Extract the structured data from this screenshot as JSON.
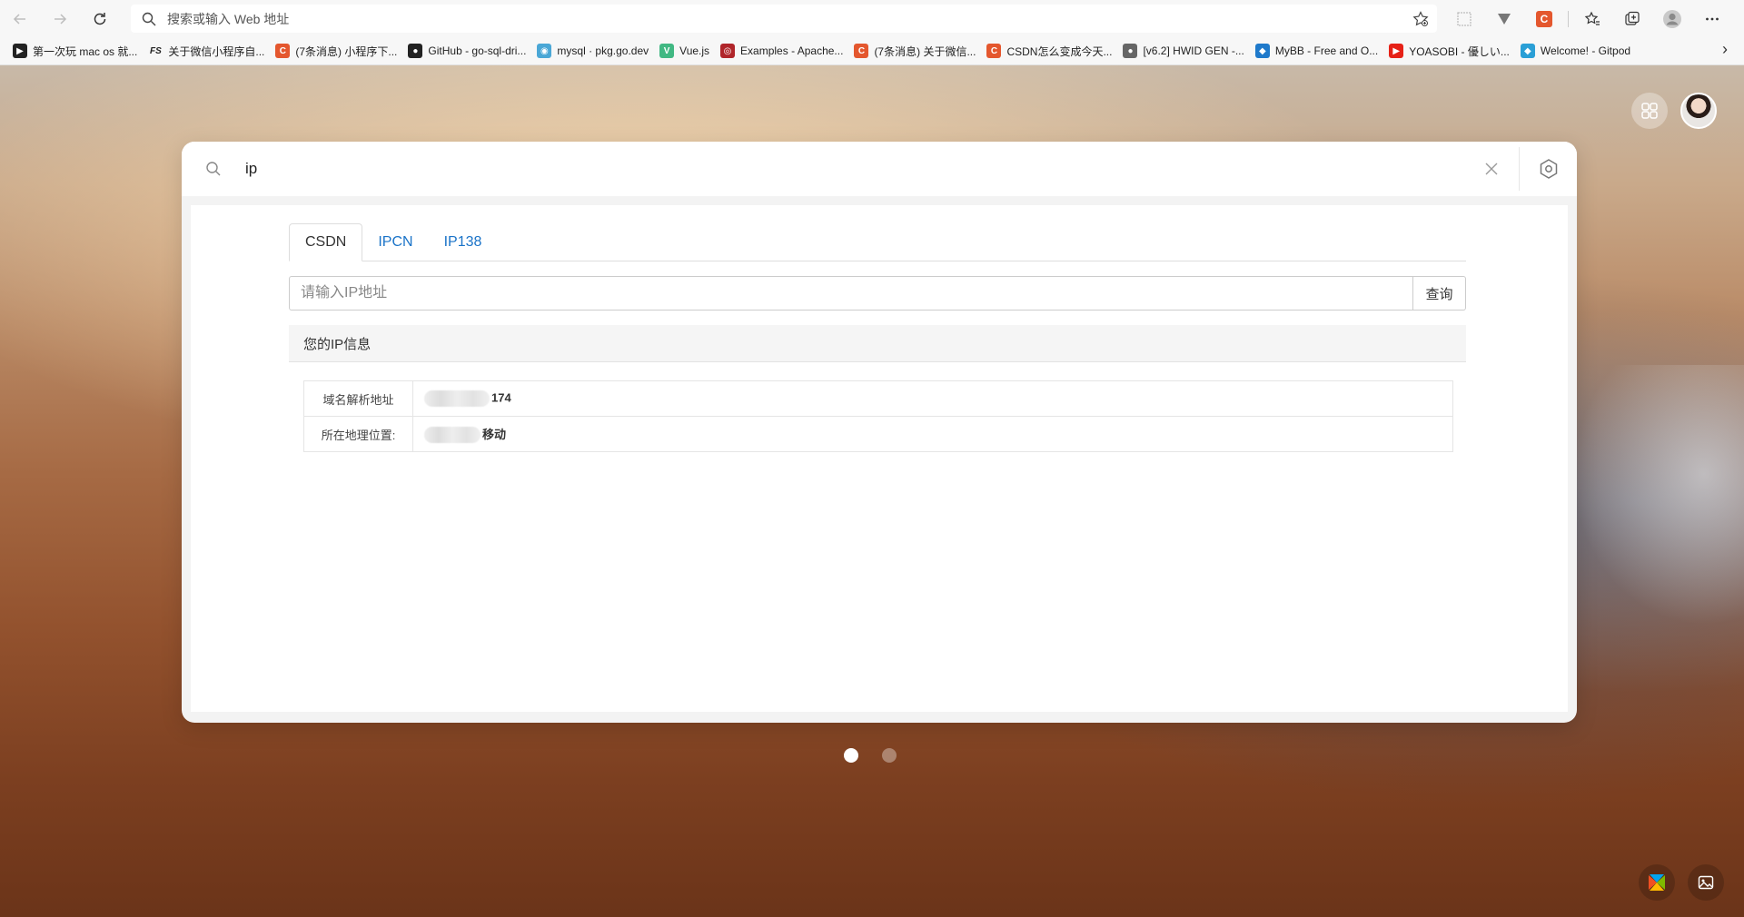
{
  "browser": {
    "address_placeholder": "搜索或输入 Web 地址",
    "bookmarks": [
      {
        "label": "第一次玩 mac os 就...",
        "icon": "vmware-icon",
        "color": "#222"
      },
      {
        "label": "关于微信小程序自...",
        "icon": "fs-icon",
        "color": "#222"
      },
      {
        "label": "(7条消息) 小程序下...",
        "icon": "csdn-icon",
        "color": "#e4572e"
      },
      {
        "label": "GitHub - go-sql-dri...",
        "icon": "github-icon",
        "color": "#222"
      },
      {
        "label": "mysql · pkg.go.dev",
        "icon": "gopher-icon",
        "color": "#4aa7d6"
      },
      {
        "label": "Vue.js",
        "icon": "vue-icon",
        "color": "#41b883"
      },
      {
        "label": "Examples - Apache...",
        "icon": "apache-icon",
        "color": "#b0252a"
      },
      {
        "label": "(7条消息) 关于微信...",
        "icon": "csdn-icon",
        "color": "#e4572e"
      },
      {
        "label": "CSDN怎么变成今天...",
        "icon": "csdn-icon",
        "color": "#e4572e"
      },
      {
        "label": "[v6.2] HWID GEN -...",
        "icon": "globe-icon",
        "color": "#666"
      },
      {
        "label": "MyBB - Free and O...",
        "icon": "mybb-icon",
        "color": "#1f7acb"
      },
      {
        "label": "YOASOBI - 優しい...",
        "icon": "youtube-icon",
        "color": "#e62117"
      },
      {
        "label": "Welcome! - Gitpod",
        "icon": "gitpod-icon",
        "color": "#2a9fd6"
      }
    ]
  },
  "search": {
    "query": "ip"
  },
  "tabs": [
    {
      "label": "CSDN",
      "active": true
    },
    {
      "label": "IPCN",
      "active": false
    },
    {
      "label": "IP138",
      "active": false
    }
  ],
  "ip_form": {
    "placeholder": "请输入IP地址",
    "button": "查询"
  },
  "info": {
    "heading": "您的IP信息",
    "rows": [
      {
        "label": "域名解析地址",
        "value": "174"
      },
      {
        "label": "所在地理位置:",
        "value": "移动"
      }
    ]
  },
  "pager": {
    "pages": 2,
    "current": 1
  }
}
